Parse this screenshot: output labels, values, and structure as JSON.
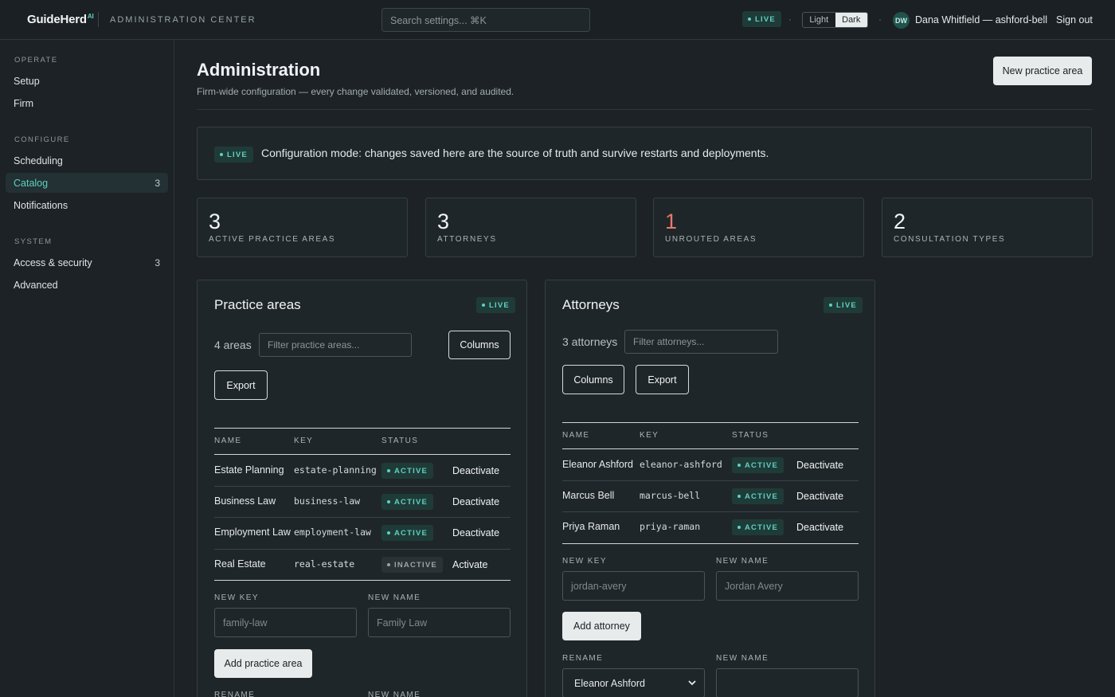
{
  "topbar": {
    "brand": "GuideHerd",
    "brand_sup": "AI",
    "section": "ADMINISTRATION CENTER",
    "search_placeholder": "Search settings...  ⌘K",
    "live": "LIVE",
    "sep": "·",
    "theme": {
      "light": "Light",
      "dark": "Dark",
      "selected": "Dark"
    },
    "avatar_initials": "DW",
    "user": "Dana Whitfield — ashford-bell",
    "sign_out": "Sign out"
  },
  "sidebar": {
    "sections": [
      {
        "title": "OPERATE",
        "items": [
          {
            "label": "Setup"
          },
          {
            "label": "Firm"
          }
        ]
      },
      {
        "title": "CONFIGURE",
        "items": [
          {
            "label": "Scheduling"
          },
          {
            "label": "Catalog",
            "count": "3",
            "active": true
          },
          {
            "label": "Notifications"
          }
        ]
      },
      {
        "title": "SYSTEM",
        "items": [
          {
            "label": "Access & security",
            "count": "3"
          },
          {
            "label": "Advanced"
          }
        ]
      }
    ]
  },
  "header": {
    "title": "Administration",
    "subtitle": "Firm-wide configuration — every change validated, versioned, and audited.",
    "new_button": "New practice area"
  },
  "banner": {
    "badge": "LIVE",
    "text": "Configuration mode: changes saved here are the source of truth and survive restarts and deployments."
  },
  "stats": [
    {
      "value": "3",
      "label": "ACTIVE PRACTICE AREAS"
    },
    {
      "value": "3",
      "label": "ATTORNEYS"
    },
    {
      "value": "1",
      "label": "UNROUTED AREAS",
      "warn": true
    },
    {
      "value": "2",
      "label": "CONSULTATION TYPES"
    }
  ],
  "practice_areas": {
    "title": "Practice areas",
    "badge": "LIVE",
    "count": "4 areas",
    "filter_placeholder": "Filter practice areas...",
    "columns_button": "Columns",
    "export_button": "Export",
    "headers": [
      "NAME",
      "KEY",
      "STATUS"
    ],
    "rows": [
      {
        "name": "Estate Planning",
        "key": "estate-planning",
        "status": "ACTIVE",
        "action": "Deactivate"
      },
      {
        "name": "Business Law",
        "key": "business-law",
        "status": "ACTIVE",
        "action": "Deactivate"
      },
      {
        "name": "Employment Law",
        "key": "employment-law",
        "status": "ACTIVE",
        "action": "Deactivate"
      },
      {
        "name": "Real Estate",
        "key": "real-estate",
        "status": "INACTIVE",
        "action": "Activate"
      }
    ],
    "new_key_label": "NEW KEY",
    "new_key_placeholder": "family-law",
    "new_name_label": "NEW NAME",
    "new_name_placeholder": "Family Law",
    "add_button": "Add practice area",
    "rename_label": "RENAME",
    "rename_new_name_label": "NEW NAME"
  },
  "attorneys": {
    "title": "Attorneys",
    "badge": "LIVE",
    "count": "3 attorneys",
    "filter_placeholder": "Filter attorneys...",
    "columns_button": "Columns",
    "export_button": "Export",
    "headers": [
      "NAME",
      "KEY",
      "STATUS"
    ],
    "rows": [
      {
        "name": "Eleanor Ashford",
        "key": "eleanor-ashford",
        "status": "ACTIVE",
        "action": "Deactivate"
      },
      {
        "name": "Marcus Bell",
        "key": "marcus-bell",
        "status": "ACTIVE",
        "action": "Deactivate"
      },
      {
        "name": "Priya Raman",
        "key": "priya-raman",
        "status": "ACTIVE",
        "action": "Deactivate"
      }
    ],
    "new_key_label": "NEW KEY",
    "new_key_placeholder": "jordan-avery",
    "new_name_label": "NEW NAME",
    "new_name_placeholder": "Jordan Avery",
    "add_button": "Add attorney",
    "rename_label": "RENAME",
    "rename_selected": "Eleanor Ashford",
    "rename_new_name_label": "NEW NAME",
    "rename_new_name_value": ""
  }
}
